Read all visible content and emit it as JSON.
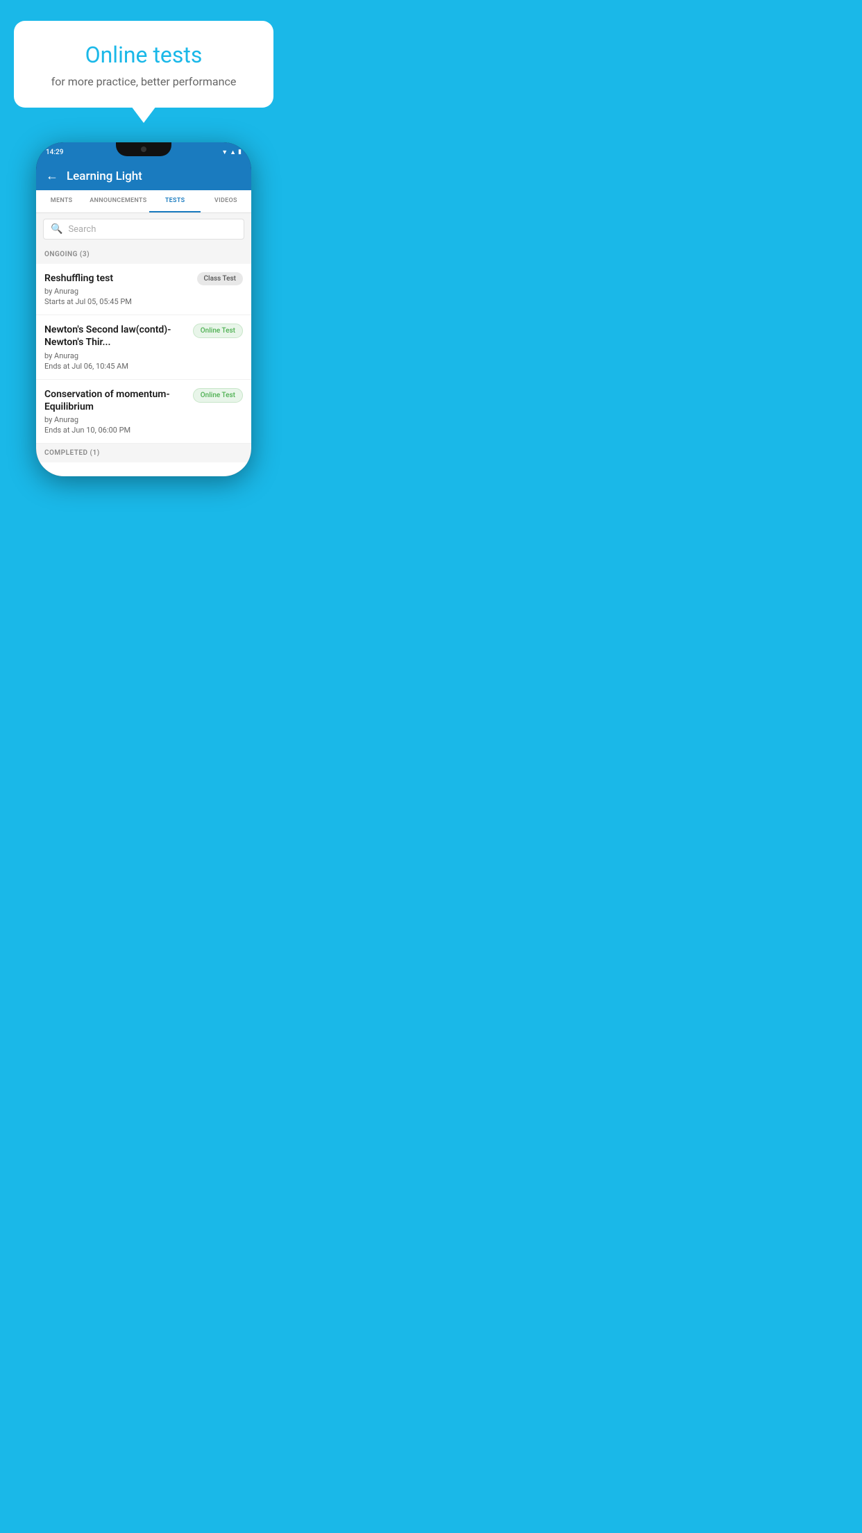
{
  "background": {
    "color": "#1ab8e8"
  },
  "speech_bubble": {
    "title": "Online tests",
    "subtitle": "for more practice, better performance"
  },
  "phone": {
    "status_bar": {
      "time": "14:29",
      "icons": [
        "wifi",
        "signal",
        "battery"
      ]
    },
    "app_header": {
      "title": "Learning Light",
      "back_label": "←"
    },
    "tabs": [
      {
        "label": "MENTS",
        "active": false
      },
      {
        "label": "ANNOUNCEMENTS",
        "active": false
      },
      {
        "label": "TESTS",
        "active": true
      },
      {
        "label": "VIDEOS",
        "active": false
      }
    ],
    "search": {
      "placeholder": "Search"
    },
    "sections": [
      {
        "header": "ONGOING (3)",
        "items": [
          {
            "title": "Reshuffling test",
            "author": "by Anurag",
            "time_label": "Starts at",
            "time_value": "Jul 05, 05:45 PM",
            "badge": "Class Test",
            "badge_type": "class"
          },
          {
            "title": "Newton's Second law(contd)-Newton's Thir...",
            "author": "by Anurag",
            "time_label": "Ends at",
            "time_value": "Jul 06, 10:45 AM",
            "badge": "Online Test",
            "badge_type": "online"
          },
          {
            "title": "Conservation of momentum-Equilibrium",
            "author": "by Anurag",
            "time_label": "Ends at",
            "time_value": "Jun 10, 06:00 PM",
            "badge": "Online Test",
            "badge_type": "online"
          }
        ]
      }
    ],
    "completed_section": {
      "header": "COMPLETED (1)"
    }
  }
}
